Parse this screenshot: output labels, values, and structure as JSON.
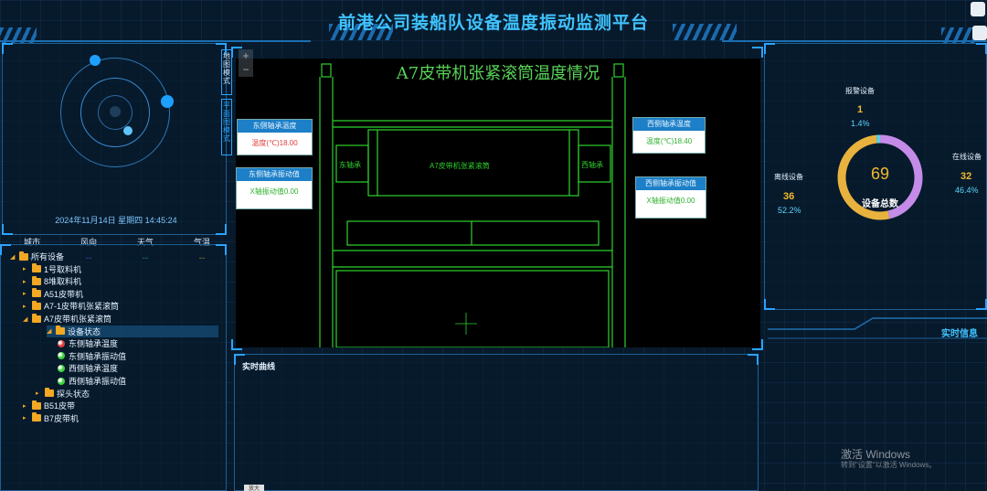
{
  "header": {
    "title": "前港公司装船队设备温度振动监测平台"
  },
  "env": {
    "datetime": "2024年11月14日 星期四 14:45:24",
    "items": [
      {
        "label": "城市",
        "value": "--",
        "color": "#33a8ff"
      },
      {
        "label": "风向",
        "value": "--",
        "color": "#8f5cff"
      },
      {
        "label": "天气",
        "value": "--",
        "color": "#31c37a"
      },
      {
        "label": "气温",
        "value": "--",
        "color": "#f2a823"
      }
    ]
  },
  "map_tabs": [
    "地图模式",
    "平面图模式"
  ],
  "zoom": {
    "plus": "+",
    "minus": "−"
  },
  "tree": {
    "nodes": [
      {
        "label": "所有设备",
        "type": "folder"
      },
      {
        "label": "1号取料机",
        "type": "folder"
      },
      {
        "label": "8堆取料机",
        "type": "folder"
      },
      {
        "label": "A51皮带机",
        "type": "folder"
      },
      {
        "label": "A7-1皮带机张紧滚筒",
        "type": "folder"
      },
      {
        "label": "A7皮带机张紧滚筒",
        "type": "folder"
      },
      {
        "label": "设备状态",
        "type": "folder"
      },
      {
        "label": "东侧轴承温度",
        "type": "led",
        "status": "#e23b3b"
      },
      {
        "label": "东侧轴承振动值",
        "type": "led",
        "status": "#3fd23f"
      },
      {
        "label": "西侧轴承温度",
        "type": "led",
        "status": "#3fd23f"
      },
      {
        "label": "西侧轴承振动值",
        "type": "led",
        "status": "#3fd23f"
      },
      {
        "label": "探头状态",
        "type": "folder"
      },
      {
        "label": "B51皮带",
        "type": "folder"
      },
      {
        "label": "B7皮带机",
        "type": "folder"
      }
    ]
  },
  "drawing": {
    "title": "A7皮带机张紧滚筒温度情况",
    "center_label": "A7皮带机张紧滚筒",
    "east_bearing": "东轴承",
    "west_bearing": "西轴承",
    "cards": {
      "east_temp": {
        "head": "东侧轴承温度",
        "body": "温度(℃)18.00",
        "color": "#e23b3b"
      },
      "east_vib": {
        "head": "东侧轴承振动值",
        "body": "X轴振动值0.00",
        "color": "#2fb02f"
      },
      "west_temp": {
        "head": "西侧轴承温度",
        "body": "温度(℃)18.40",
        "color": "#2fb02f"
      },
      "west_vib": {
        "head": "西侧轴承振动值",
        "body": "X轴振动值0.00",
        "color": "#2fb02f"
      }
    }
  },
  "curve": {
    "title": "实时曲线",
    "button": "放大"
  },
  "stats": {
    "total": "69",
    "total_label": "设备总数",
    "alarm": {
      "label": "报警设备",
      "count": "1",
      "pct": "1.4%",
      "fraction": 0.014,
      "color": "#5fd0e8"
    },
    "online": {
      "label": "在线设备",
      "count": "32",
      "pct": "46.4%",
      "fraction": 0.464,
      "color": "#c58be8"
    },
    "offline": {
      "label": "离线设备",
      "count": "36",
      "pct": "52.2%",
      "fraction": 0.522,
      "color": "#e8b23e"
    }
  },
  "realtime": {
    "title": "实时信息"
  },
  "watermark": {
    "line1": "激活 Windows",
    "line2": "转到\"设置\"以激活 Windows。"
  }
}
